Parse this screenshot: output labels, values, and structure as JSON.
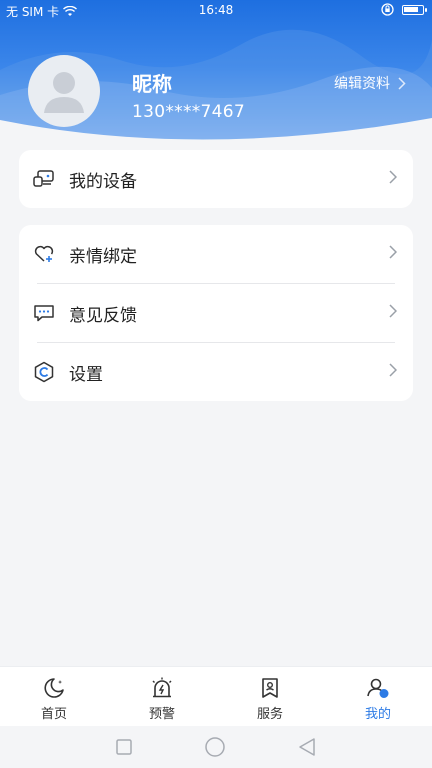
{
  "status_bar": {
    "carrier": "无 SIM 卡",
    "time": "16:48"
  },
  "profile": {
    "nickname": "昵称",
    "phone": "130****7467",
    "edit_label": "编辑资料"
  },
  "menu_group_1": [
    {
      "label": "我的设备",
      "icon": "device-icon"
    }
  ],
  "menu_group_2": [
    {
      "label": "亲情绑定",
      "icon": "heart-plus-icon"
    },
    {
      "label": "意见反馈",
      "icon": "feedback-icon"
    },
    {
      "label": "设置",
      "icon": "settings-icon"
    }
  ],
  "tabbar": {
    "items": [
      {
        "label": "首页",
        "icon": "moon-icon",
        "active": false
      },
      {
        "label": "预警",
        "icon": "alarm-icon",
        "active": false
      },
      {
        "label": "服务",
        "icon": "service-icon",
        "active": false
      },
      {
        "label": "我的",
        "icon": "user-icon",
        "active": true
      }
    ]
  },
  "colors": {
    "accent": "#2d7be5",
    "header_top": "#1e6fe0",
    "page_bg": "#f4f5f7"
  }
}
